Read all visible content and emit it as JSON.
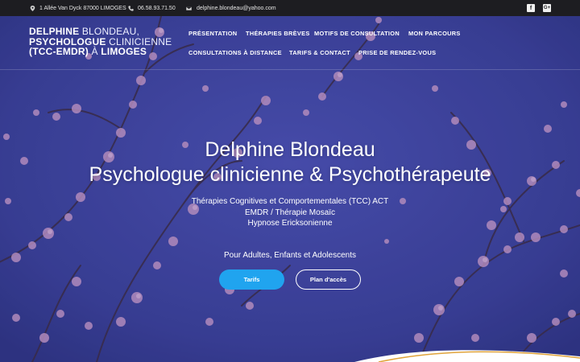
{
  "topbar": {
    "address": "1 Allée Van Dyck 87000 LIMOGES",
    "phone": "06.58.93.71.50",
    "email": "delphine.blondeau@yahoo.com",
    "social_facebook": "f",
    "social_google": "G+"
  },
  "site_title": {
    "line1_bold": "DELPHINE",
    "line1_light": "BLONDEAU,",
    "line2_bold": "PSYCHOLOGUE",
    "line2_light": "CLINICIENNE",
    "line3_bold": "(TCC-EMDR)",
    "line3_light": "À",
    "line3_bold2": "LIMOGES"
  },
  "nav": {
    "items": [
      "PRÉSENTATION",
      "THÉRAPIES BRÈVES",
      "MOTIFS DE CONSULTATION",
      "MON PARCOURS",
      "CONSULTATIONS À DISTANCE",
      "TARIFS & CONTACT",
      "PRISE DE RENDEZ-VOUS"
    ]
  },
  "hero": {
    "name": "Delphine Blondeau",
    "profession": "Psychologue clinicienne & Psychothérapeute",
    "therapies": [
      "Thérapies Cognitives et Comportementales (TCC) ACT",
      "EMDR / Thérapie Mosaïc",
      "Hypnose Ericksonienne"
    ],
    "audience": "Pour Adultes, Enfants et Adolescents",
    "button_tarifs": "Tarifs",
    "button_plan": "Plan d'accès"
  },
  "colors": {
    "topbar_bg": "#1d1d21",
    "hero_bg": "#3a3f95",
    "blossom": "#c99ac6",
    "button_primary": "#20a4ef",
    "curve_accent": "#e0a33a"
  },
  "icons": [
    "location-pin-icon",
    "phone-icon",
    "envelope-icon",
    "facebook-icon",
    "google-plus-icon"
  ]
}
